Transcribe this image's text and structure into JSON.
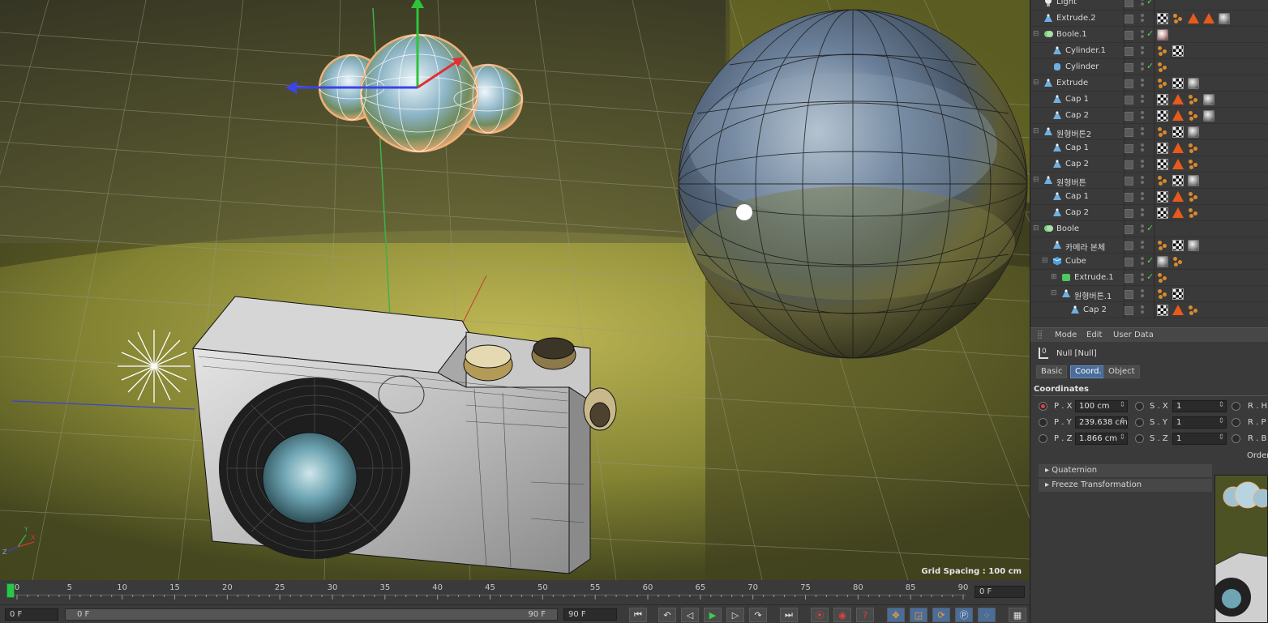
{
  "viewport": {
    "grid_spacing": "Grid Spacing : 100 cm",
    "axis_labels": {
      "x": "X",
      "y": "Y",
      "z": "Z"
    }
  },
  "timeline": {
    "ruler": [
      "0",
      "5",
      "10",
      "15",
      "20",
      "25",
      "30",
      "35",
      "40",
      "45",
      "50",
      "55",
      "60",
      "65",
      "70",
      "75",
      "80",
      "85",
      "90"
    ],
    "current_frame": "0 F",
    "start_frame": "0 F",
    "range_start": "0 F",
    "range_end": "90 F",
    "end_frame": "90 F"
  },
  "transport": {
    "buttons": [
      "go-to-start",
      "prev-key",
      "play-reverse",
      "play-forward",
      "next-key",
      "loop",
      "go-to-end",
      "record-keyframe",
      "auto-keyframe",
      "keyframe-selection",
      "move-key",
      "scale-key",
      "rotate-key",
      "param-key",
      "pla-key",
      "timeline-window"
    ]
  },
  "object_manager": {
    "objects": [
      {
        "name": "Light",
        "icon": "light-icon",
        "indent": 0,
        "tree": "",
        "check": true,
        "tags": []
      },
      {
        "name": "Extrude.2",
        "icon": "extrude-icon",
        "indent": 0,
        "tree": "",
        "check": false,
        "tags": [
          "checker",
          "dots",
          "tri",
          "tri",
          "mat"
        ]
      },
      {
        "name": "Boole.1",
        "icon": "boole-icon",
        "indent": 0,
        "tree": "⊟",
        "check": true,
        "tags": [
          "mat-red"
        ]
      },
      {
        "name": "Cylinder.1",
        "icon": "extrude-icon",
        "indent": 1,
        "tree": "",
        "check": false,
        "tags": [
          "dots",
          "checker"
        ]
      },
      {
        "name": "Cylinder",
        "icon": "cylinder-icon",
        "indent": 1,
        "tree": "",
        "check": true,
        "tags": [
          "dots"
        ]
      },
      {
        "name": "Extrude",
        "icon": "extrude-icon",
        "indent": 0,
        "tree": "⊟",
        "check": false,
        "tags": [
          "dots",
          "checker",
          "mat"
        ]
      },
      {
        "name": "Cap 1",
        "icon": "extrude-icon",
        "indent": 1,
        "tree": "",
        "check": false,
        "tags": [
          "checker",
          "tri",
          "dots",
          "mat"
        ]
      },
      {
        "name": "Cap 2",
        "icon": "extrude-icon",
        "indent": 1,
        "tree": "",
        "check": false,
        "tags": [
          "checker",
          "tri",
          "dots",
          "mat"
        ]
      },
      {
        "name": "원형버튼2",
        "icon": "extrude-icon",
        "indent": 0,
        "tree": "⊟",
        "check": false,
        "tags": [
          "dots",
          "checker",
          "mat"
        ]
      },
      {
        "name": "Cap 1",
        "icon": "extrude-icon",
        "indent": 1,
        "tree": "",
        "check": false,
        "tags": [
          "checker",
          "tri",
          "dots"
        ]
      },
      {
        "name": "Cap 2",
        "icon": "extrude-icon",
        "indent": 1,
        "tree": "",
        "check": false,
        "tags": [
          "checker",
          "tri",
          "dots"
        ]
      },
      {
        "name": "원형버튼",
        "icon": "extrude-icon",
        "indent": 0,
        "tree": "⊟",
        "check": false,
        "tags": [
          "dots",
          "checker",
          "mat"
        ]
      },
      {
        "name": "Cap 1",
        "icon": "extrude-icon",
        "indent": 1,
        "tree": "",
        "check": false,
        "tags": [
          "checker",
          "tri",
          "dots"
        ]
      },
      {
        "name": "Cap 2",
        "icon": "extrude-icon",
        "indent": 1,
        "tree": "",
        "check": false,
        "tags": [
          "checker",
          "tri",
          "dots"
        ]
      },
      {
        "name": "Boole",
        "icon": "boole-icon",
        "indent": 0,
        "tree": "⊟",
        "check": true,
        "tags": []
      },
      {
        "name": "카메라 본체",
        "icon": "extrude-icon",
        "indent": 1,
        "tree": "",
        "check": false,
        "tags": [
          "dots",
          "checker",
          "mat"
        ]
      },
      {
        "name": "Cube",
        "icon": "cube-icon",
        "indent": 1,
        "tree": "⊟",
        "check": true,
        "tags": [
          "mat",
          "dots"
        ]
      },
      {
        "name": "Extrude.1",
        "icon": "extrude-green-icon",
        "indent": 2,
        "tree": "⊞",
        "check": true,
        "tags": [
          "dots"
        ]
      },
      {
        "name": "원형버튼.1",
        "icon": "extrude-icon",
        "indent": 2,
        "tree": "⊟",
        "check": false,
        "tags": [
          "dots",
          "checker"
        ]
      },
      {
        "name": "Cap 2",
        "icon": "extrude-icon",
        "indent": 3,
        "tree": "",
        "check": false,
        "tags": [
          "checker",
          "tri",
          "dots"
        ]
      }
    ]
  },
  "attributes": {
    "menu": {
      "mode": "Mode",
      "edit": "Edit",
      "user_data": "User Data"
    },
    "object_title": "Null [Null]",
    "tabs": [
      "Basic",
      "Coord.",
      "Object"
    ],
    "active_tab": "Coord.",
    "section": "Coordinates",
    "rows": [
      {
        "p_label": "P . X",
        "p_val": "100 cm",
        "s_label": "S . X",
        "s_val": "1",
        "r_label": "R . H"
      },
      {
        "p_label": "P . Y",
        "p_val": "239.638 cm",
        "s_label": "S . Y",
        "s_val": "1",
        "r_label": "R . P"
      },
      {
        "p_label": "P . Z",
        "p_val": "1.866 cm",
        "s_label": "S . Z",
        "s_val": "1",
        "r_label": "R . B"
      }
    ],
    "order_label": "Order",
    "folds": [
      "Quaternion",
      "Freeze Transformation"
    ]
  },
  "colors": {
    "accent": "#4a6d9a",
    "active_key": "#e04040",
    "check": "#57d05a",
    "tag_orange": "#e85a1c"
  }
}
